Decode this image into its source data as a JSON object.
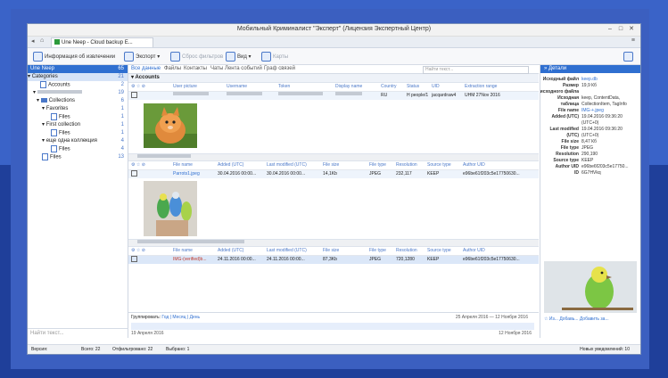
{
  "window": {
    "title": "Мобильный Криминалист \"Эксперт\" (Лицензия Экспертный Центр)"
  },
  "tab": {
    "label": "Une Neep - Cloud backup E..."
  },
  "toolbar": {
    "info_label": "Информация об извлечении",
    "export_label": "Экспорт",
    "filter_label": "Сброс фильтров",
    "view_label": "Вид",
    "map_label": "Карты"
  },
  "left_panel": {
    "header": "Une Neep",
    "header_count": "65",
    "items": [
      {
        "label": "Categories",
        "count": "21"
      },
      {
        "label": "Accounts",
        "count": "2"
      },
      {
        "label": "",
        "count": "19"
      },
      {
        "label": "Collections",
        "count": "6"
      },
      {
        "label": "Favorites",
        "count": "1"
      },
      {
        "label": "Files",
        "count": "1"
      },
      {
        "label": "First collection",
        "count": "1"
      },
      {
        "label": "Files",
        "count": "1"
      },
      {
        "label": "еще одна коллекция",
        "count": "4"
      },
      {
        "label": "Files",
        "count": "4"
      },
      {
        "label": "Files",
        "count": "13"
      }
    ],
    "search_placeholder": "Найти текст..."
  },
  "center": {
    "tabs": [
      "Все данные",
      "Файлы",
      "Контакты",
      "Чаты",
      "Лента событий",
      "Граф связей"
    ],
    "search_placeholder": "Найти текст...",
    "group_accounts": {
      "title": "Accounts",
      "columns": [
        "User picture",
        "Username",
        "Token",
        "Display name",
        "Country",
        "Status",
        "UID",
        "Extraction range"
      ],
      "row": {
        "country": "RU",
        "status": "H people/1",
        "uid": "jacqardraw4",
        "range": "UHM 27Nov 2016"
      }
    },
    "group_files1": {
      "columns": [
        "File name",
        "Added (UTC)",
        "Last modified (UTC)",
        "File size",
        "File type",
        "Resolution",
        "Source type",
        "Author UID"
      ],
      "row": {
        "name": "Parrots1.jpeg",
        "added": "30.04.2016 00:00...",
        "modified": "30.04.2016 00:00...",
        "size": "14,1Kb",
        "type": "JPEG",
        "res": "232,117",
        "source": "KEEP",
        "author": "e96be61f203c5e17750630..."
      }
    },
    "group_files2": {
      "columns": [
        "File name",
        "Added (UTC)",
        "Last modified (UTC)",
        "File size",
        "File type",
        "Resolution",
        "Source type",
        "Author UID"
      ],
      "row": {
        "name": "IMG-(verified)b...",
        "added": "24.11.2016 00:00...",
        "modified": "24.11.2016 00:00...",
        "size": "87,3Kb",
        "type": "JPEG",
        "res": "720,1280",
        "source": "KEEP",
        "author": "e96be61f203c5e17750630..."
      }
    },
    "timeline": {
      "label": "Группировать:",
      "options": "Год | Месяц | День",
      "range": "25 Апреля 2016 — 12 Ноября 2016",
      "start": "19 Апреля 2016",
      "end": "12 Ноября 2016"
    }
  },
  "details": {
    "header": "Детали",
    "props": [
      {
        "k": "Исходный файл",
        "v": "keep.db",
        "link": true
      },
      {
        "k": "Размер",
        "v": "19,9 Кб"
      },
      {
        "k": "исходного файла",
        "v": ""
      },
      {
        "k": "Исходная",
        "v": "keep, ContentData,"
      },
      {
        "k": "таблица",
        "v": "CollectionItem, TagInfo"
      },
      {
        "k": "File name",
        "v": "IMG-+.jpeg",
        "link": true
      },
      {
        "k": "Added (UTC)",
        "v": "19.04.2016 09:36:20"
      },
      {
        "k": "",
        "v": "(UTC+0)"
      },
      {
        "k": "Last modified",
        "v": "19.04.2016 09:36:20"
      },
      {
        "k": "(UTC)",
        "v": "(UTC+0)"
      },
      {
        "k": "File size",
        "v": "8,47 Кб"
      },
      {
        "k": "File type",
        "v": "JPEG"
      },
      {
        "k": "Resolution",
        "v": "290,190"
      },
      {
        "k": "Source type",
        "v": "KEEP"
      },
      {
        "k": "Author UID",
        "v": "e96be6f203c5e17750..."
      },
      {
        "k": "ID",
        "v": "6G7HVkq"
      }
    ],
    "actions": "Из... Добавь... Добавить за..."
  },
  "status": {
    "version": "Версия:",
    "total": "Всего: 22",
    "filtered": "Отфильтровано: 22",
    "selected": "Выбрано: 1",
    "notifications": "Новых уведомлений: 10"
  },
  "colors": {
    "accent": "#2f6fd0",
    "background": "#2f55b5"
  }
}
